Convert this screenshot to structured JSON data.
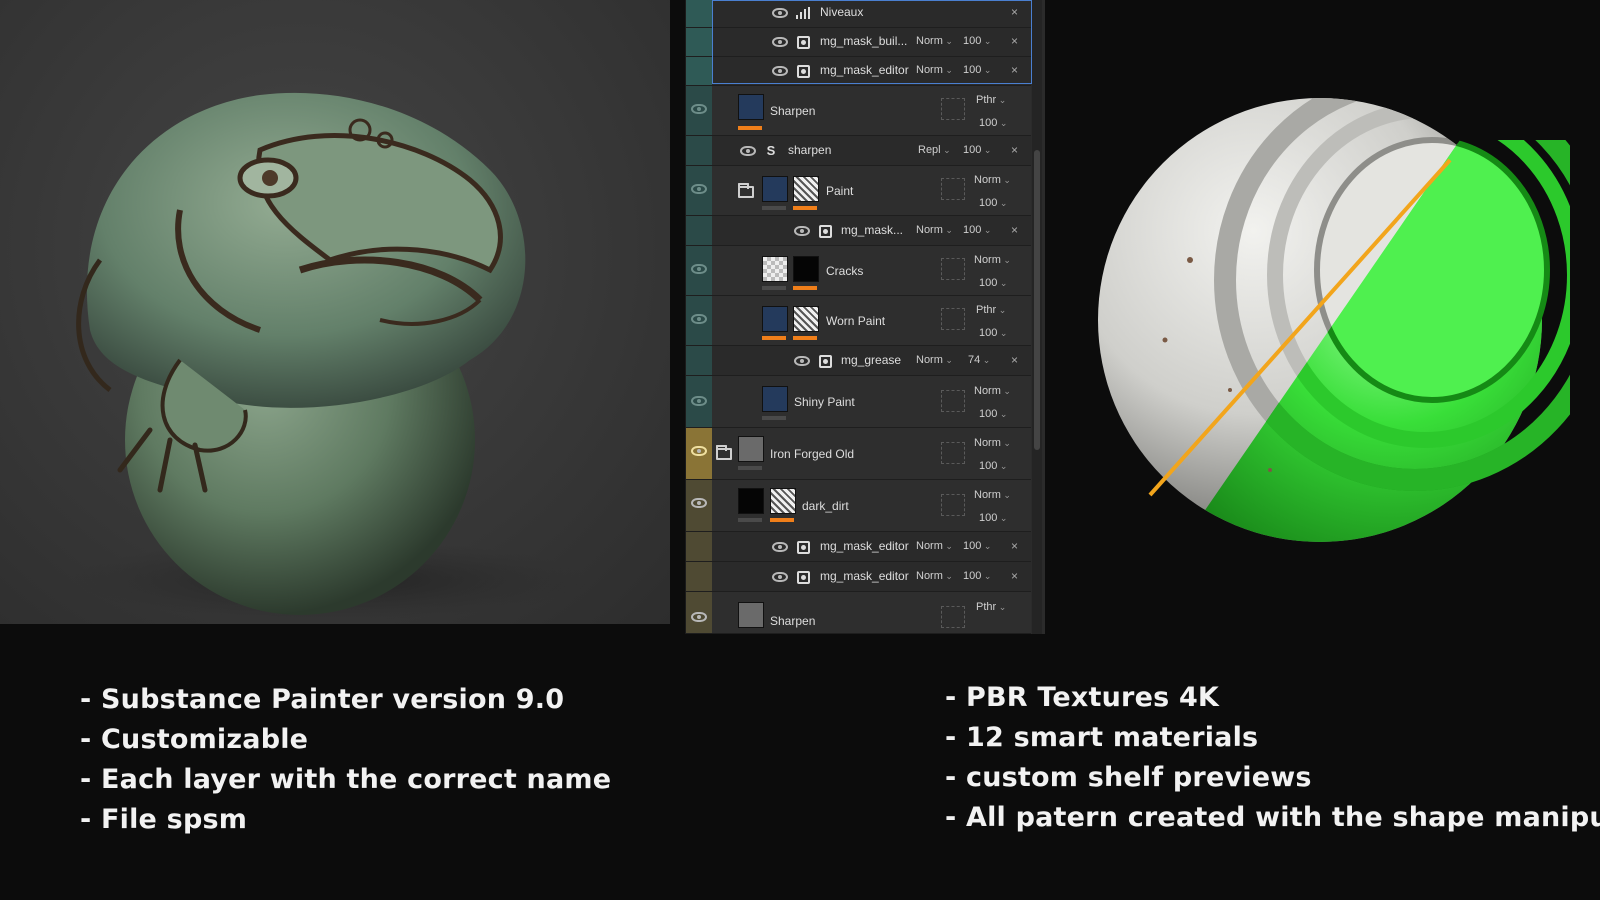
{
  "layer_panel": {
    "rows": {
      "niveaux": {
        "name": "Niveaux"
      },
      "mask_build": {
        "name": "mg_mask_buil...",
        "blend": "Norm",
        "opacity": "100"
      },
      "mask_editor_top": {
        "name": "mg_mask_editor",
        "blend": "Norm",
        "opacity": "100"
      },
      "sharpen": {
        "name": "Sharpen",
        "blend": "Pthr",
        "opacity": "100"
      },
      "sharpen_filter": {
        "name": "sharpen",
        "blend": "Repl",
        "opacity": "100"
      },
      "paint": {
        "name": "Paint",
        "blend": "Norm",
        "opacity": "100"
      },
      "paint_mask": {
        "name": "mg_mask...",
        "blend": "Norm",
        "opacity": "100"
      },
      "cracks": {
        "name": "Cracks",
        "blend": "Norm",
        "opacity": "100"
      },
      "worn_paint": {
        "name": "Worn Paint",
        "blend": "Pthr",
        "opacity": "100"
      },
      "grease": {
        "name": "mg_grease",
        "blend": "Norm",
        "opacity": "74"
      },
      "shiny_paint": {
        "name": "Shiny Paint",
        "blend": "Norm",
        "opacity": "100"
      },
      "iron_forged": {
        "name": "Iron Forged Old",
        "blend": "Norm",
        "opacity": "100"
      },
      "dark_dirt": {
        "name": "dark_dirt",
        "blend": "Norm",
        "opacity": "100"
      },
      "mask_editor_a": {
        "name": "mg_mask_editor",
        "blend": "Norm",
        "opacity": "100"
      },
      "mask_editor_b": {
        "name": "mg_mask_editor",
        "blend": "Norm",
        "opacity": "100"
      },
      "sharpen_bottom": {
        "name": "Sharpen",
        "blend": "Pthr"
      }
    },
    "close_glyph": "×"
  },
  "features_left": [
    "- Substance Painter version 9.0",
    "- Customizable",
    "- Each layer with the correct name",
    "- File spsm"
  ],
  "features_right": [
    "- PBR Textures 4K",
    "- 12 smart materials",
    "- custom shelf previews",
    "- All patern created with the shape manipulator"
  ],
  "colors": {
    "accent_orange": "#f07f1a",
    "mask_green": "#2fd12f",
    "divider_line": "#f2a51c",
    "statue_green": "#6f8a70",
    "metal_white": "#d9d9d6"
  }
}
